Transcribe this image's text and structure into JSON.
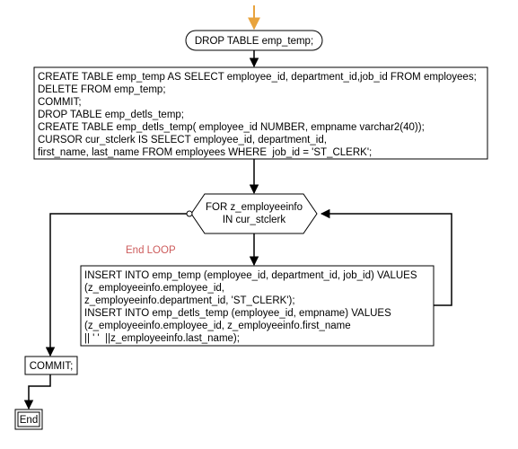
{
  "nodes": {
    "drop": {
      "text": "DROP TABLE emp_temp;"
    },
    "block1": {
      "lines": [
        "CREATE TABLE emp_temp AS SELECT employee_id, department_id,job_id FROM employees;",
        "DELETE FROM emp_temp;",
        "COMMIT;",
        "DROP TABLE emp_detls_temp;",
        "CREATE TABLE emp_detls_temp( employee_id NUMBER, empname varchar2(40));",
        "CURSOR cur_stclerk IS SELECT employee_id, department_id,",
        "first_name, last_name FROM employees WHERE  job_id = 'ST_CLERK';"
      ]
    },
    "loop": {
      "line1": "FOR z_employeeinfo",
      "line2": "IN cur_stclerk"
    },
    "loopLabel": "End LOOP",
    "block2": {
      "lines": [
        "INSERT INTO emp_temp (employee_id, department_id, job_id) VALUES",
        "(z_employeeinfo.employee_id,",
        "z_employeeinfo.department_id, 'ST_CLERK');",
        "INSERT INTO emp_detls_temp (employee_id, empname) VALUES",
        "(z_employeeinfo.employee_id, z_employeeinfo.first_name",
        "|| ' '  ||z_employeeinfo.last_name);"
      ]
    },
    "commit": "COMMIT;",
    "end": "End"
  }
}
